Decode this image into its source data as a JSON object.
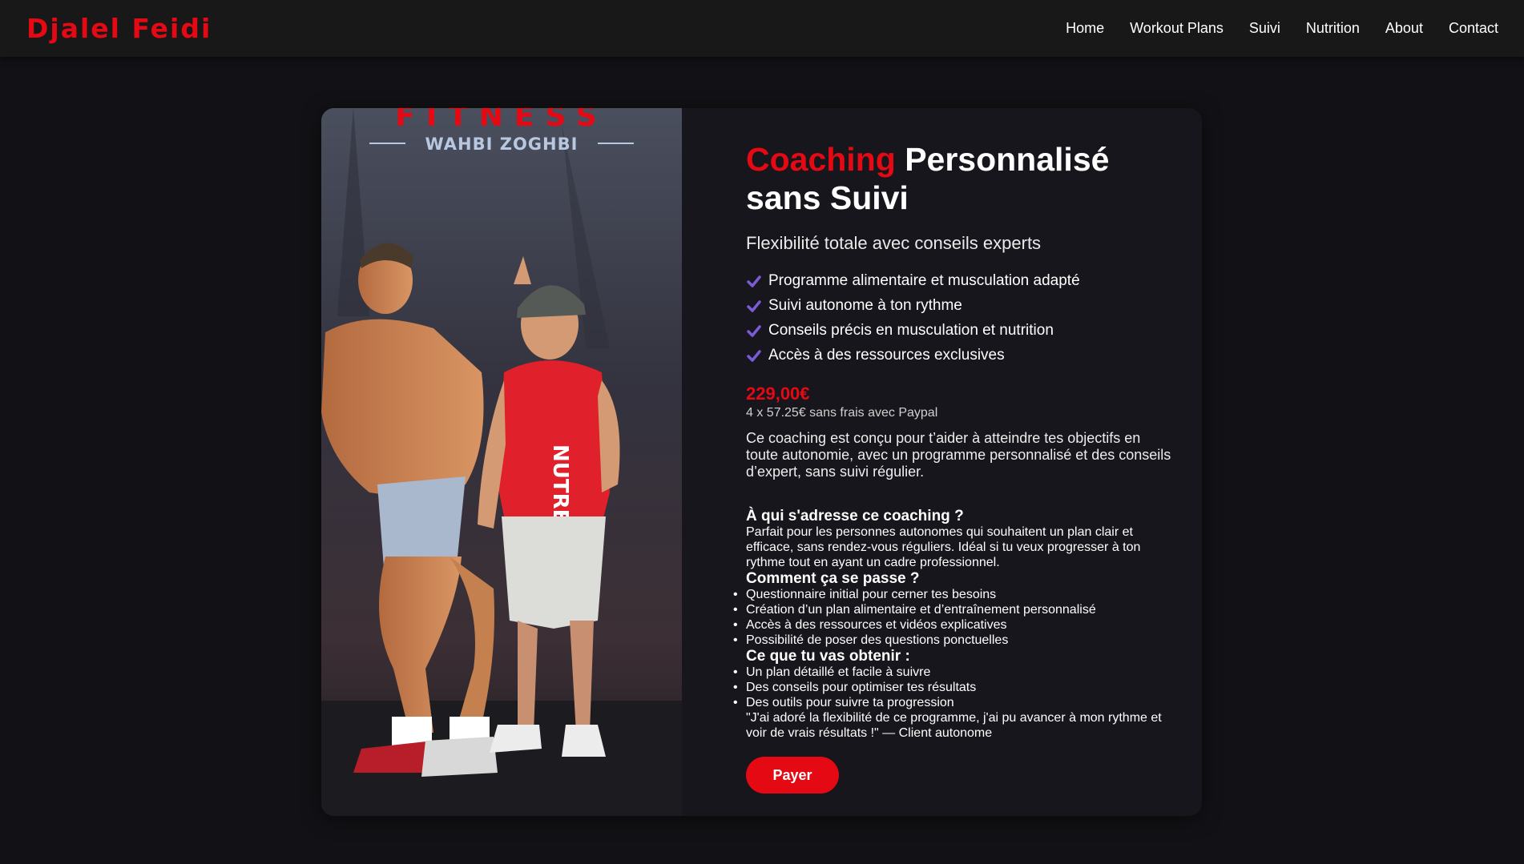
{
  "header": {
    "brand": "Djalel Feidi",
    "nav": [
      "Home",
      "Workout Plans",
      "Suivi",
      "Nutrition",
      "About",
      "Contact"
    ]
  },
  "photo": {
    "banner_text": "FITNESS",
    "banner_sub": "WAHBI ZOGHBI",
    "shirt_text": "NUTREX",
    "alt": "Deux hommes posant dans une salle de sport"
  },
  "offer": {
    "title_highlight": "Coaching",
    "title_rest": " Personnalisé sans Suivi",
    "subtitle": "Flexibilité totale avec conseils experts",
    "features": [
      "Programme alimentaire et musculation adapté",
      "Suivi autonome à ton rythme",
      "Conseils précis en musculation et nutrition",
      "Accès à des ressources exclusives"
    ],
    "price": "229,00€",
    "installment": "4 x 57.25€ sans frais avec Paypal",
    "description": "Ce coaching est conçu pour t’aider à atteindre tes objectifs en toute autonomie, avec un programme personnalisé et des conseils d’expert, sans suivi régulier.",
    "section1_title": "À qui s'adresse ce coaching ?",
    "section1_text": "Parfait pour les personnes autonomes qui souhaitent un plan clair et efficace, sans rendez-vous réguliers. Idéal si tu veux progresser à ton rythme tout en ayant un cadre professionnel.",
    "section2_title": "Comment ça se passe ?",
    "section2_items": [
      "Questionnaire initial pour cerner tes besoins",
      "Création d’un plan alimentaire et d’entraînement personnalisé",
      "Accès à des ressources et vidéos explicatives",
      "Possibilité de poser des questions ponctuelles"
    ],
    "section3_title": "Ce que tu vas obtenir :",
    "section3_items": [
      "Un plan détaillé et facile à suivre",
      "Des conseils pour optimiser tes résultats",
      "Des outils pour suivre ta progression"
    ],
    "testimonial": "\"J'ai adoré la flexibilité de ce programme, j'ai pu avancer à mon rythme et voir de vrais résultats !\" — Client autonome",
    "pay_label": "Payer"
  },
  "colors": {
    "accent": "#e50914",
    "check": "#7b5cd6",
    "background": "#121216",
    "card": "#16161c",
    "header": "#181818"
  }
}
